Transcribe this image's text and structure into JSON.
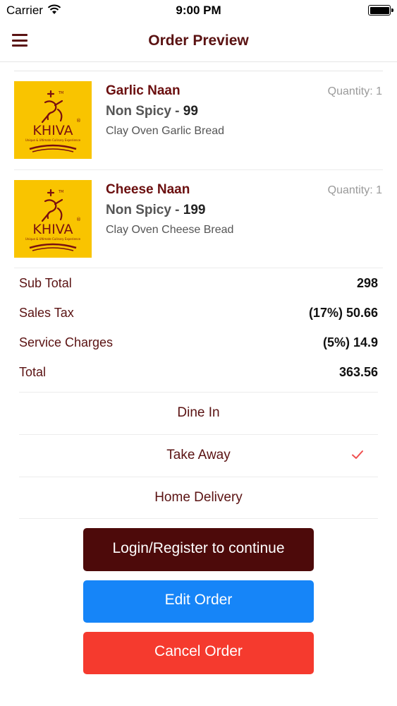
{
  "status_bar": {
    "carrier": "Carrier",
    "time": "9:00 PM"
  },
  "nav": {
    "title": "Order Preview",
    "menu_icon": "hamburger-menu-icon"
  },
  "logo": {
    "brand": "KHIVA",
    "tagline": "Unique & Ultimate Culinary Experience",
    "bg_color": "#f9c400"
  },
  "items": [
    {
      "name": "Garlic Naan",
      "quantity": "Quantity: 1",
      "spice": "Non Spicy - ",
      "price": "99",
      "description": "Clay Oven Garlic Bread"
    },
    {
      "name": "Cheese Naan",
      "quantity": "Quantity: 1",
      "spice": "Non Spicy - ",
      "price": "199",
      "description": "Clay Oven Cheese Bread"
    }
  ],
  "totals": [
    {
      "label": "Sub Total",
      "value": "298"
    },
    {
      "label": "Sales Tax",
      "value": "(17%) 50.66"
    },
    {
      "label": "Service Charges",
      "value": "(5%) 14.9"
    },
    {
      "label": "Total",
      "value": "363.56"
    }
  ],
  "order_types": [
    {
      "label": "Dine In",
      "selected": false
    },
    {
      "label": "Take Away",
      "selected": true
    },
    {
      "label": "Home Delivery",
      "selected": false
    }
  ],
  "buttons": {
    "login": "Login/Register to continue",
    "edit": "Edit Order",
    "cancel": "Cancel Order"
  },
  "colors": {
    "brand_maroon": "#5a1212",
    "edit_blue": "#1685f8",
    "cancel_red": "#f53a2e",
    "check_red": "#f05050"
  }
}
